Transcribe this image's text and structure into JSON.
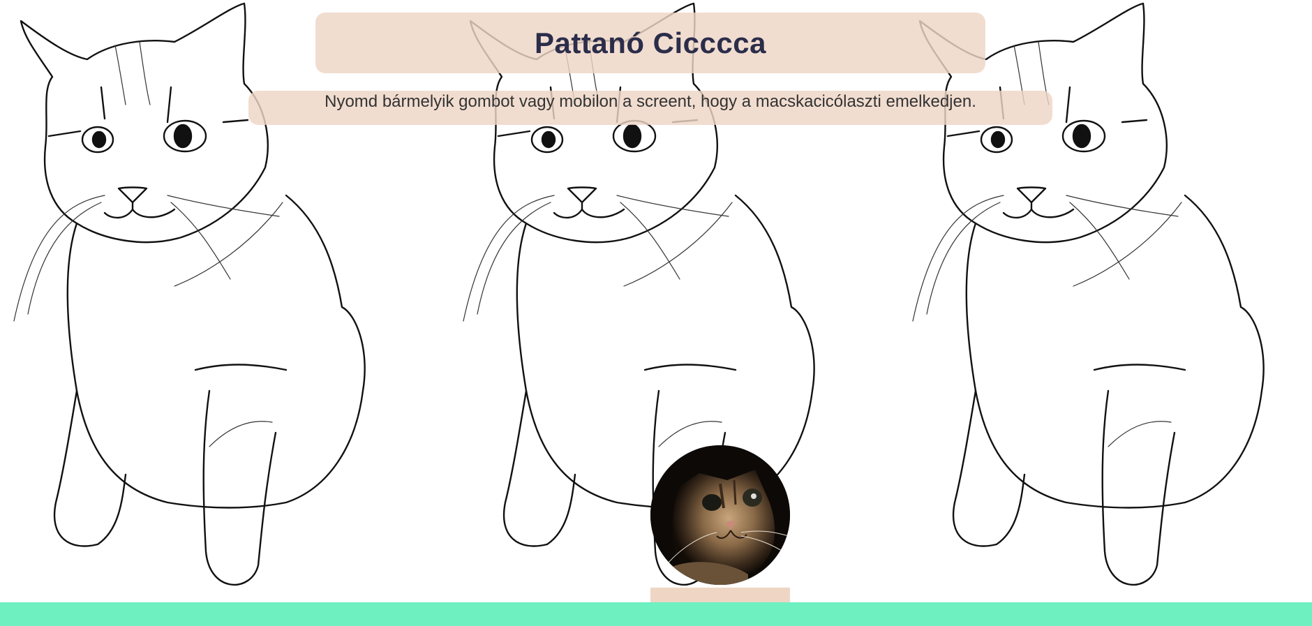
{
  "title": "Pattanó Cicccca",
  "instruction": "Nyomd bármelyik gombot vagy mobilon a screent, hogy a macskacicólaszti emelkedjen.",
  "background": {
    "pattern": "cat-line-drawing",
    "repeat_count": 3
  },
  "player": {
    "icon": "cat-photo-ball"
  },
  "colors": {
    "panel": "#efd6c4",
    "title_text": "#2b2d4a",
    "ground": "#6ef0c1",
    "platform": "#efd6c4"
  }
}
